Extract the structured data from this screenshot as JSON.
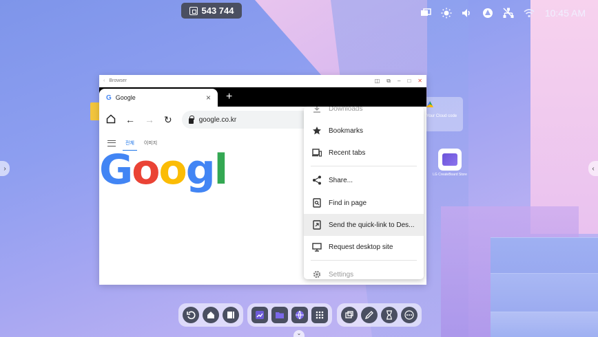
{
  "desktop": {
    "code_badge": "543 744",
    "status_time": "10:45 AM",
    "status_icons": [
      "screen-share-icon",
      "brightness-icon",
      "volume-icon",
      "cloud-icon",
      "network-icon",
      "wifi-icon"
    ],
    "cloud_card_text": "Your Cloud code",
    "store_label": "LG CreateBoard Store"
  },
  "browser": {
    "window_title": "Browser",
    "tab_title": "Google",
    "tab_favicon": "G",
    "new_tab_label": "+",
    "address": "google.co.kr",
    "search_nav": {
      "all_label": "전체",
      "images_label": "이미지"
    },
    "logo_letters": [
      "G",
      "o",
      "o",
      "g",
      "l"
    ]
  },
  "menu": {
    "items": [
      {
        "label": "Downloads",
        "icon": "download-icon"
      },
      {
        "label": "Bookmarks",
        "icon": "star-icon"
      },
      {
        "label": "Recent tabs",
        "icon": "devices-icon"
      },
      {
        "label": "Share...",
        "icon": "share-icon"
      },
      {
        "label": "Find in page",
        "icon": "find-icon"
      },
      {
        "label": "Send the quick-link to Des...",
        "icon": "send-link-icon"
      },
      {
        "label": "Request desktop site",
        "icon": "monitor-icon"
      },
      {
        "label": "Settings",
        "icon": "gear-icon"
      }
    ]
  },
  "taskbar": {
    "group1": [
      "back-icon",
      "home-icon",
      "multitask-icon"
    ],
    "group2": [
      "whiteboard-icon",
      "folder-icon",
      "browser-icon",
      "apps-grid-icon"
    ],
    "group3": [
      "screen-share-icon",
      "pen-icon",
      "timer-icon",
      "more-icon"
    ]
  },
  "colors": {
    "accent_blue": "#1a73e8",
    "taskbar_button": "#4a4f61",
    "google_blue": "#4285f4",
    "google_red": "#ea4335",
    "google_yellow": "#fbbc05",
    "google_green": "#34a853"
  }
}
